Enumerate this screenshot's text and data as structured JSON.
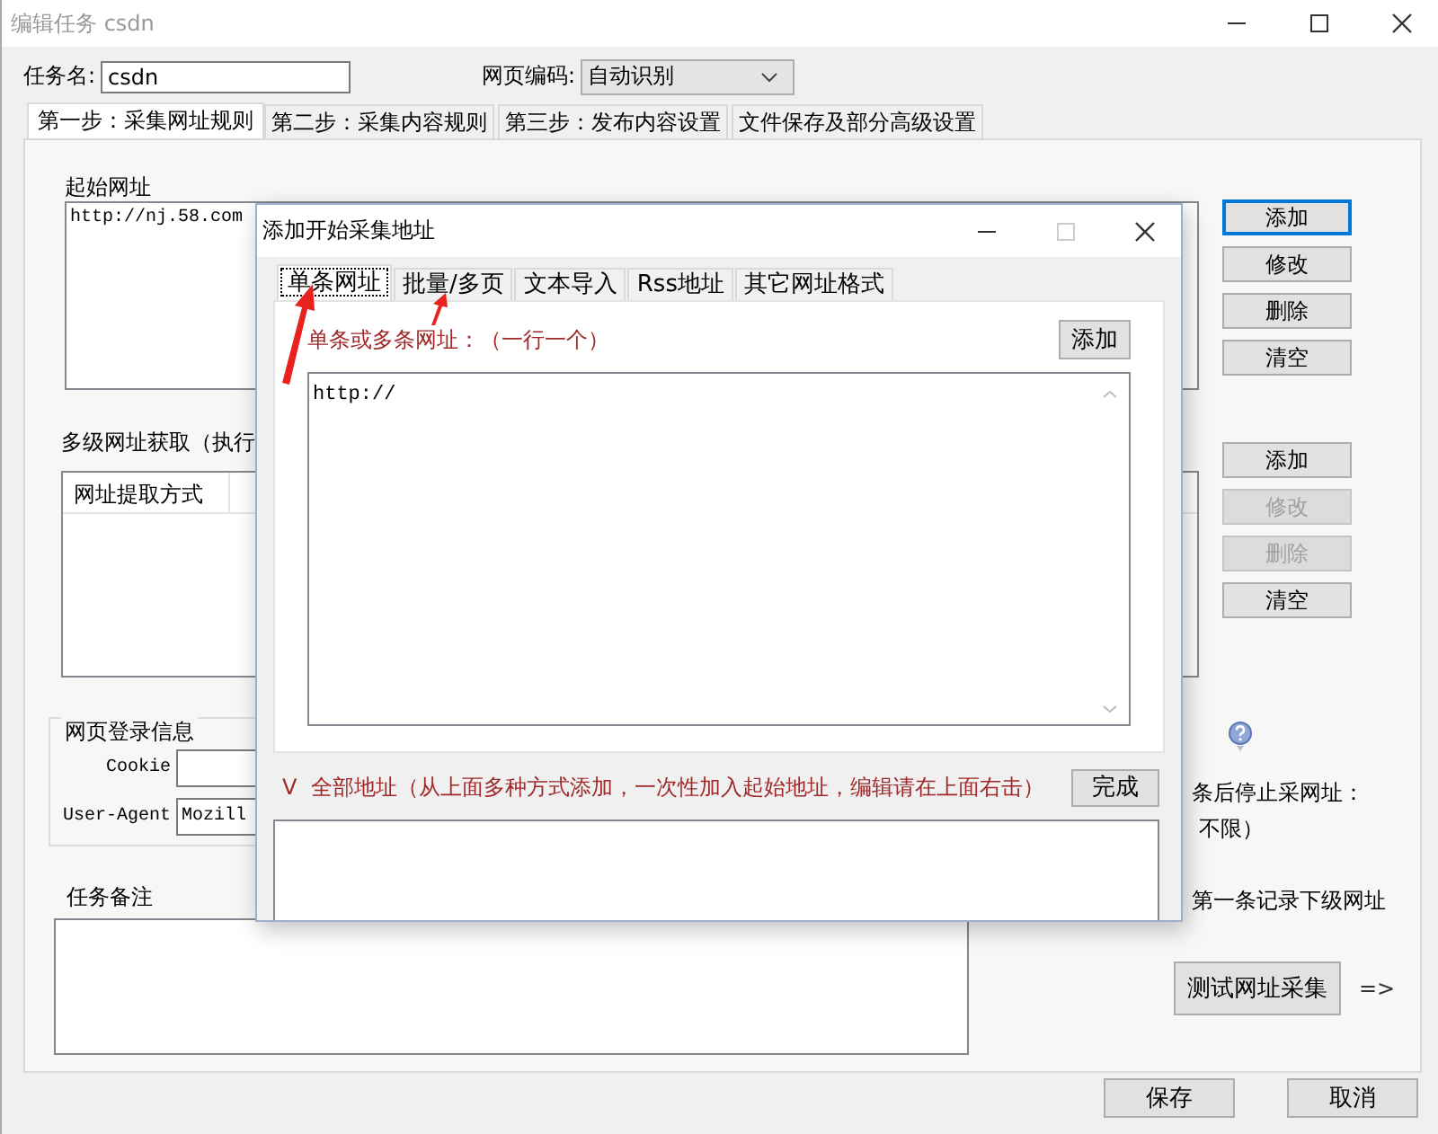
{
  "window": {
    "title": "编辑任务 csdn",
    "active": false
  },
  "task_name": {
    "label": "任务名:",
    "value": "csdn"
  },
  "encoding": {
    "label": "网页编码:",
    "value": "自动识别"
  },
  "tabs": [
    {
      "label": "第一步：采集网址规则",
      "selected": true
    },
    {
      "label": "第二步：采集内容规则",
      "selected": false
    },
    {
      "label": "第三步：发布内容设置",
      "selected": false
    },
    {
      "label": "文件保存及部分高级设置",
      "selected": false
    }
  ],
  "start_urls": {
    "title": "起始网址",
    "value": "http://nj.58.com",
    "buttons": [
      {
        "label": "添加",
        "focused": true,
        "disabled": false
      },
      {
        "label": "修改",
        "focused": false,
        "disabled": false
      },
      {
        "label": "删除",
        "focused": false,
        "disabled": false
      },
      {
        "label": "清空",
        "focused": false,
        "disabled": false
      }
    ]
  },
  "multi_level": {
    "title": "多级网址获取（执行",
    "columns": [
      "网址提取方式"
    ],
    "buttons": [
      {
        "label": "添加",
        "focused": false,
        "disabled": false
      },
      {
        "label": "修改",
        "focused": false,
        "disabled": true
      },
      {
        "label": "删除",
        "focused": false,
        "disabled": true
      },
      {
        "label": "清空",
        "focused": false,
        "disabled": false
      }
    ]
  },
  "login": {
    "title": "网页登录信息",
    "fields": [
      {
        "label": "Cookie"
      },
      {
        "label": "User-Agent",
        "value": "Mozill"
      }
    ]
  },
  "notes": {
    "title": "任务备注"
  },
  "right_texts": [
    "条后停止采网址：",
    "不限）",
    "第一条记录下级网址"
  ],
  "test_button": "测试网址采集",
  "next_arrow": "=>",
  "footer_buttons": [
    "保存",
    "取消"
  ],
  "dialog": {
    "title": "添加开始采集地址",
    "tabs": [
      {
        "label": "单条网址",
        "selected": true
      },
      {
        "label": "批量/多页",
        "selected": false
      },
      {
        "label": "文本导入",
        "selected": false
      },
      {
        "label": "Rss地址",
        "selected": false
      },
      {
        "label": "其它网址格式",
        "selected": false
      }
    ],
    "hint": "单条或多条网址：（一行一个）",
    "add_button": "添加",
    "urls_value": "http://",
    "toggle": "V",
    "all_label": "全部地址（从上面多种方式添加，一次性加入起始地址，编辑请在上面右击）",
    "done_button": "完成"
  }
}
